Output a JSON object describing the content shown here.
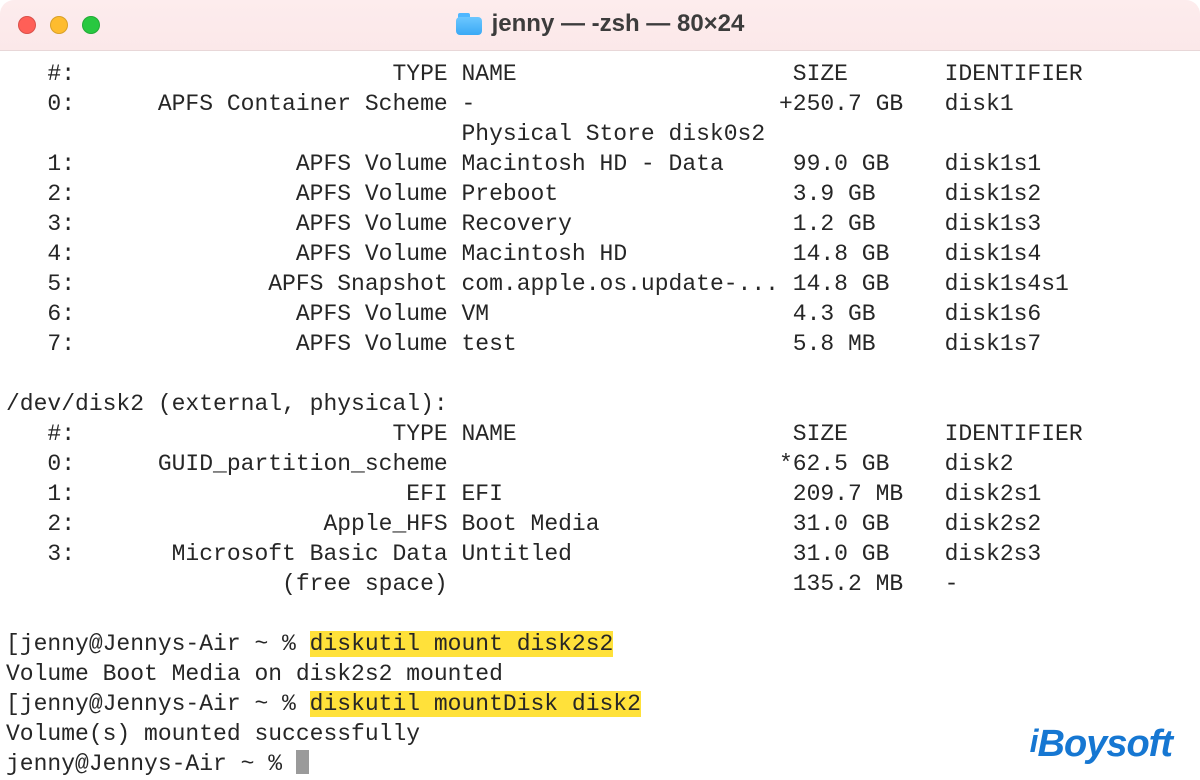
{
  "window": {
    "title": "jenny — -zsh — 80×24"
  },
  "table1": {
    "hdr_num": "   #:",
    "hdr_type": "                       TYPE",
    "hdr_name": "NAME",
    "hdr_size": "SIZE",
    "hdr_id": "IDENTIFIER",
    "r0_num": "   0:",
    "r0_type": "      APFS Container Scheme",
    "r0_name": "-",
    "r0_size": "+250.7 GB",
    "r0_id": "disk1",
    "phys": "                                 Physical Store disk0s2",
    "r1_num": "   1:",
    "r1_type": "                APFS Volume",
    "r1_name": "Macintosh HD - Data",
    "r1_size": "99.0 GB",
    "r1_id": "disk1s1",
    "r2_num": "   2:",
    "r2_type": "                APFS Volume",
    "r2_name": "Preboot",
    "r2_size": "3.9 GB",
    "r2_id": "disk1s2",
    "r3_num": "   3:",
    "r3_type": "                APFS Volume",
    "r3_name": "Recovery",
    "r3_size": "1.2 GB",
    "r3_id": "disk1s3",
    "r4_num": "   4:",
    "r4_type": "                APFS Volume",
    "r4_name": "Macintosh HD",
    "r4_size": "14.8 GB",
    "r4_id": "disk1s4",
    "r5_num": "   5:",
    "r5_type": "              APFS Snapshot",
    "r5_name": "com.apple.os.update-...",
    "r5_size": "14.8 GB",
    "r5_id": "disk1s4s1",
    "r6_num": "   6:",
    "r6_type": "                APFS Volume",
    "r6_name": "VM",
    "r6_size": "4.3 GB",
    "r6_id": "disk1s6",
    "r7_num": "   7:",
    "r7_type": "                APFS Volume",
    "r7_name": "test",
    "r7_size": "5.8 MB",
    "r7_id": "disk1s7"
  },
  "disk2_header": "/dev/disk2 (external, physical):",
  "table2": {
    "hdr_num": "   #:",
    "hdr_type": "                       TYPE",
    "hdr_name": "NAME",
    "hdr_size": "SIZE",
    "hdr_id": "IDENTIFIER",
    "r0_num": "   0:",
    "r0_type": "      GUID_partition_scheme",
    "r0_name": "",
    "r0_size": "*62.5 GB",
    "r0_id": "disk2",
    "r1_num": "   1:",
    "r1_type": "                        EFI",
    "r1_name": "EFI",
    "r1_size": "209.7 MB",
    "r1_id": "disk2s1",
    "r2_num": "   2:",
    "r2_type": "                  Apple_HFS",
    "r2_name": "Boot Media",
    "r2_size": "31.0 GB",
    "r2_id": "disk2s2",
    "r3_num": "   3:",
    "r3_type": "       Microsoft Basic Data",
    "r3_name": "Untitled",
    "r3_size": "31.0 GB",
    "r3_id": "disk2s3",
    "rfree_type": "               (free space)",
    "rfree_size": "135.2 MB",
    "rfree_id": "-"
  },
  "prompt1": {
    "pre": "[jenny@Jennys-Air ~ % ",
    "cmd": "diskutil mount disk2s2",
    "post": ""
  },
  "result1": "Volume Boot Media on disk2s2 mounted",
  "prompt2": {
    "pre": "[jenny@Jennys-Air ~ % ",
    "cmd": "diskutil mountDisk disk2",
    "post": ""
  },
  "result2": "Volume(s) mounted successfully",
  "prompt3": "jenny@Jennys-Air ~ % ",
  "watermark": "iBoysoft"
}
